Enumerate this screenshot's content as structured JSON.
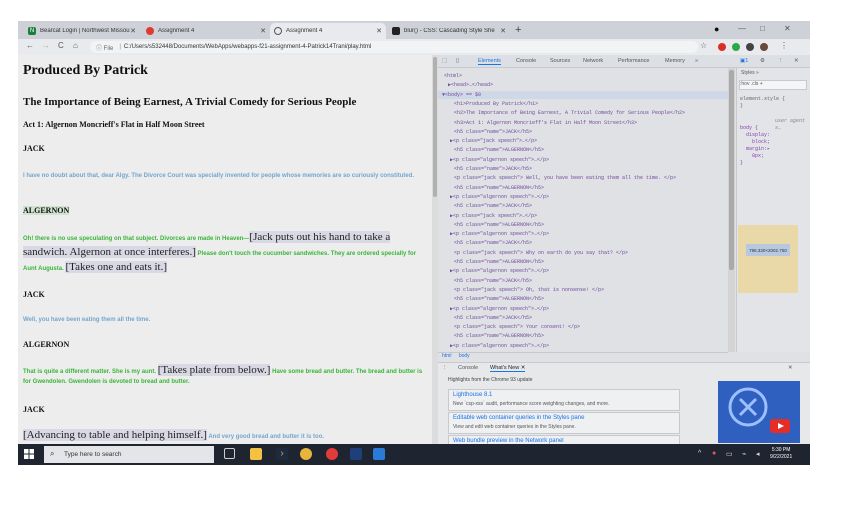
{
  "browser": {
    "tabs": [
      {
        "title": "Bearcat Login | Northwest Missou",
        "icon": "n-logo-icon",
        "color": "#1b7f3a"
      },
      {
        "title": "Assignment 4",
        "icon": "canvas-icon",
        "color": "#e03a2f"
      },
      {
        "title": "Assignment 4",
        "icon": "globe-icon",
        "color": "#555555",
        "active": true
      },
      {
        "title": "blur() - CSS: Cascading Style She",
        "icon": "mdn-icon",
        "color": "#222222"
      }
    ],
    "new_tab": "+",
    "nav": {
      "back": "←",
      "forward": "→",
      "reload": "C",
      "home": "⌂"
    },
    "address": {
      "info": "ⓘ File",
      "url": "C:/Users/s532448/Documents/WebApps/webapps-f21-assignment-4-Patrick14Trani/play.html"
    },
    "window_controls": {
      "minimize": "—",
      "maximize": "□",
      "close": "✕"
    }
  },
  "play": {
    "h1": "Produced By Patrick",
    "h2": "The Importance of Being Earnest, A Trivial Comedy for Serious People",
    "h3": "Act 1: Algernon Moncrieff's Flat in Half Moon Street",
    "blocks": [
      {
        "speaker": "JACK",
        "type": "jack",
        "parts": [
          {
            "t": "I have no doubt about that, dear Algy. The Divorce Court was specially invented for people whose memories are so curiously constituted."
          }
        ]
      },
      {
        "speaker": "ALGERNON",
        "type": "alg",
        "parts": [
          {
            "t": "Oh! there is no use speculating on that subject. Divorces are made in Heaven—"
          },
          {
            "s": "[Jack puts out his hand to take a sandwich. Algernon at once interferes.]"
          },
          {
            "t": " Please don't touch the cucumber sandwiches. They are ordered specially for Aunt Augusta. "
          },
          {
            "s": "[Takes one and eats it.]"
          }
        ]
      },
      {
        "speaker": "JACK",
        "type": "jack",
        "parts": [
          {
            "t": "Well, you have been eating them all the time."
          }
        ]
      },
      {
        "speaker": "ALGERNON",
        "type": "alg",
        "parts": [
          {
            "t": "That is quite a different matter. She is my aunt. "
          },
          {
            "s": "[Takes plate from below.]"
          },
          {
            "t": " Have some bread and butter. The bread and butter is for Gwendolen. Gwendolen is devoted to bread and butter."
          }
        ]
      },
      {
        "speaker": "JACK",
        "type": "jack",
        "parts": [
          {
            "s": "[Advancing to table and helping himself.]"
          },
          {
            "t": " And very good bread and butter it is too."
          }
        ]
      }
    ]
  },
  "devtools": {
    "tabs": [
      "Elements",
      "Console",
      "Sources",
      "Network",
      "Performance",
      "Memory",
      "»"
    ],
    "dom_lines": [
      "<html>",
      "▶<head>…</head>",
      "▼<body> == $0",
      "<h1>Produced By Patrick</h1>",
      "<h2>The Importance of Being Earnest, A Trivial Comedy for Serious People</h2>",
      "<h3>Act 1: Algernon Moncrieff's Flat in Half Moon Street</h3>",
      "<h5 class=\"name\">JACK</h5>",
      "▶<p class=\"jack speech\">…</p>",
      "<h5 class=\"name\">ALGERNON</h5>",
      "▶<p class=\"algernon speech\">…</p>",
      "<h5 class=\"name\">JACK</h5>",
      "<p class=\"jack speech\"> Well, you have been eating them all the time. </p>",
      "<h5 class=\"name\">ALGERNON</h5>",
      "▶<p class=\"algernon speech\">…</p>",
      "<h5 class=\"name\">JACK</h5>",
      "▶<p class=\"jack speech\">…</p>",
      "<h5 class=\"name\">ALGERNON</h5>",
      "▶<p class=\"algernon speech\">…</p>",
      "<h5 class=\"name\">JACK</h5>",
      "<p class=\"jack speech\"> Why on earth do you say that? </p>",
      "<h5 class=\"name\">ALGERNON</h5>",
      "▶<p class=\"algernon speech\">…</p>",
      "<h5 class=\"name\">JACK</h5>",
      "<p class=\"jack speech\"> Oh, that is nonsense! </p>",
      "<h5 class=\"name\">ALGERNON</h5>",
      "▶<p class=\"algernon speech\">…</p>",
      "<h5 class=\"name\">JACK</h5>",
      "<p class=\"jack speech\"> Your consent! </p>",
      "<h5 class=\"name\">ALGERNON</h5>",
      "▶<p class=\"algernon speech\">…</p>"
    ],
    "breadcrumbs": [
      "html",
      "body"
    ],
    "styles": {
      "tabs": "Styles  »",
      "filter": ":hov .cls +",
      "element_style": "element.style {\n}",
      "ua_label": "user agent s…",
      "rule": "body {\n  display:\n    block;\n  margin:▸\n    8px;\n}",
      "box_value": "796.330×2002.750"
    },
    "drawer": {
      "tabs": [
        "Console",
        "What's New ✕"
      ],
      "close": "✕",
      "highlights": "Highlights from the Chrome 93 update",
      "cards": [
        {
          "title": "Lighthouse 8.1",
          "desc": "New `csp-xss` audit, performance score weighting changes, and more."
        },
        {
          "title": "Editable web container queries in the Styles pane",
          "desc": "View and edit web container queries in the Styles pane."
        },
        {
          "title": "Web bundle preview in the Network panel",
          "desc": ""
        }
      ]
    }
  },
  "taskbar": {
    "search_placeholder": "Type here to search",
    "time": "5:30 PM",
    "date": "9/22/2021"
  }
}
